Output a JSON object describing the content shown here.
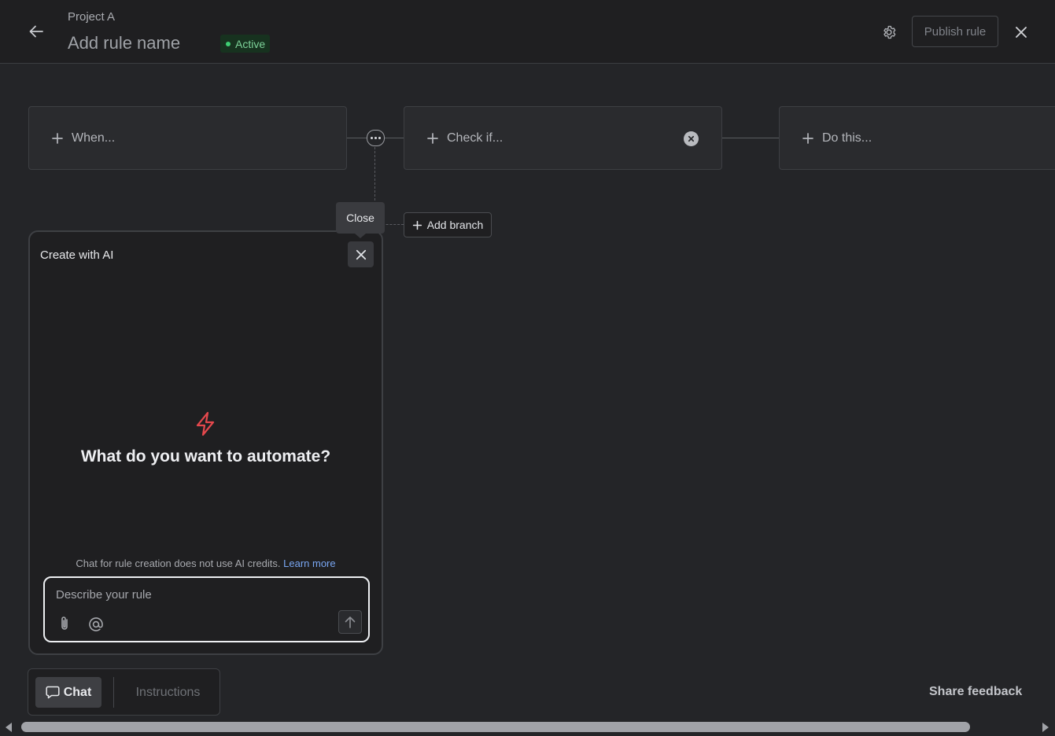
{
  "header": {
    "project_name": "Project A",
    "rule_name": "Add rule name",
    "status": "Active",
    "publish_label": "Publish rule",
    "icons": [
      "back-arrow-icon",
      "gear-icon",
      "close-icon"
    ]
  },
  "flow": {
    "when_label": "When...",
    "check_label": "Check if...",
    "do_label": "Do this...",
    "add_branch_label": "Add branch",
    "icons": [
      "plus-icon",
      "more-icon",
      "remove-icon"
    ]
  },
  "tooltip": {
    "text": "Close"
  },
  "ai_panel": {
    "title": "Create with AI",
    "heading": "What do you want to automate?",
    "note": "Chat for rule creation does not use AI credits.",
    "learn_more": "Learn more",
    "placeholder": "Describe your rule",
    "value": "",
    "icons": [
      "lightning-bolt-icon",
      "paperclip-icon",
      "at-sign-icon",
      "arrow-up-icon"
    ]
  },
  "tabs": {
    "chat": "Chat",
    "instructions": "Instructions",
    "selected": "Chat"
  },
  "footer": {
    "share_feedback": "Share feedback"
  },
  "colors": {
    "background": "#242528",
    "header": "#1f1f21",
    "status_green": "#3ecf73",
    "accent_bolt": "#e5484d",
    "link": "#79a6f2"
  }
}
